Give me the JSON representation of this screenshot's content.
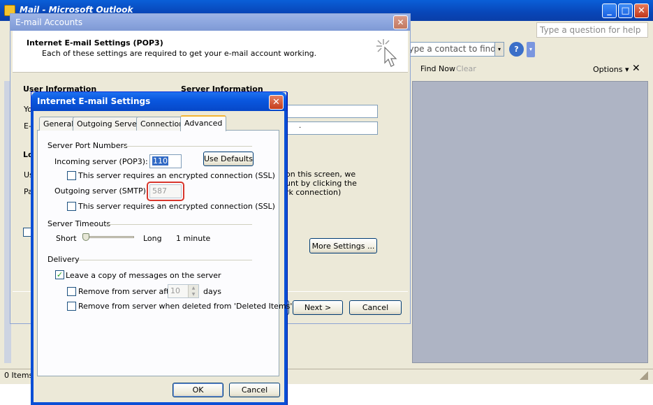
{
  "outlook": {
    "title": "Mail - Microsoft Outlook",
    "help_placeholder": "Type a question for help",
    "contact_placeholder": "Type a contact to find",
    "help_glyph": "?",
    "chevron": "▾",
    "find_now": "Find Now",
    "clear": "Clear",
    "options": "Options ▾",
    "close_glyph": "✕",
    "status": "0 Items",
    "window_buttons": {
      "minimize": "_",
      "maximize": "□",
      "close": "✕"
    }
  },
  "email_accounts": {
    "title": "E-mail Accounts",
    "close_glyph": "✕",
    "heading": "Internet E-mail Settings (POP3)",
    "subheading": "Each of these settings are required to get your e-mail account working.",
    "user_information": "User Information",
    "server_information": "Server Information",
    "label_yo": "Yo",
    "label_e": "E-",
    "label_lo": "Lo",
    "label_us": "Us",
    "label_pa": "Pa",
    "server_field_2_value": ".",
    "test_text_line1": "on this screen, we",
    "test_text_line2": "unt by clicking the",
    "test_text_line3": "rk connection)",
    "more_settings": "More Settings ...",
    "next": "Next >",
    "cancel": "Cancel"
  },
  "internet_settings": {
    "title": "Internet E-mail Settings",
    "close_glyph": "✕",
    "tabs": [
      "General",
      "Outgoing Server",
      "Connection",
      "Advanced"
    ],
    "active_tab": "Advanced",
    "server_port_numbers": "Server Port Numbers",
    "incoming_label": "Incoming server (POP3):",
    "incoming_value": "110",
    "use_defaults": "Use Defaults",
    "ssl_incoming": "This server requires an encrypted connection (SSL)",
    "outgoing_label": "Outgoing server (SMTP):",
    "outgoing_value": "587",
    "ssl_outgoing": "This server requires an encrypted connection (SSL)",
    "server_timeouts": "Server Timeouts",
    "short": "Short",
    "long": "Long",
    "timeout_value": "1 minute",
    "timeout_level": 0.05,
    "delivery": "Delivery",
    "leave_copy": "Leave a copy of messages on the server",
    "leave_copy_checked": true,
    "check_glyph": "✓",
    "remove_after": "Remove from server after",
    "remove_after_days": "10",
    "days": "days",
    "remove_deleted": "Remove from server when deleted from 'Deleted Items'",
    "ok": "OK",
    "cancel": "Cancel"
  }
}
